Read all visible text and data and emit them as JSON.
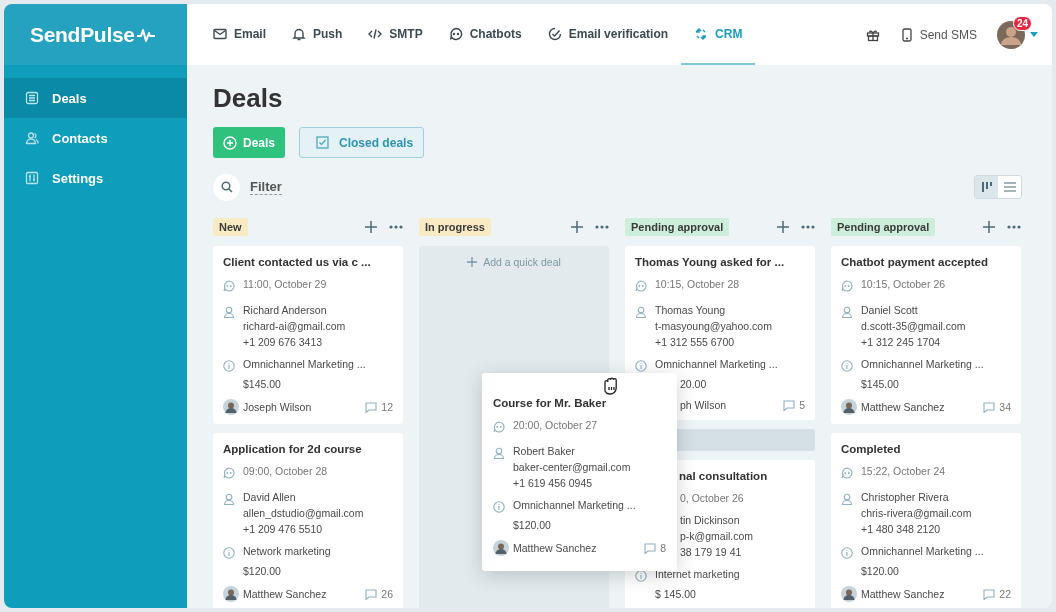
{
  "logo": "SendPulse",
  "nav": [
    {
      "label": "Email",
      "selected": false
    },
    {
      "label": "Push",
      "selected": false
    },
    {
      "label": "SMTP",
      "selected": false
    },
    {
      "label": "Chatbots",
      "selected": false
    },
    {
      "label": "Email verification",
      "selected": false
    },
    {
      "label": "CRM",
      "selected": true
    }
  ],
  "header_right": {
    "sms": "Send SMS",
    "badge": "24"
  },
  "sidebar": [
    {
      "label": "Deals",
      "selected": true
    },
    {
      "label": "Contacts",
      "selected": false
    },
    {
      "label": "Settings",
      "selected": false
    }
  ],
  "title": "Deals",
  "actions": {
    "add": "Deals",
    "closed": "Closed deals"
  },
  "filter": "Filter",
  "view": [
    {
      "selected": true
    },
    {
      "selected": false
    }
  ],
  "columns": [
    {
      "label": "New",
      "color": "#f8ebc4",
      "cards": [
        {
          "kind": "deal",
          "title": {
            "text": "Client contacted us via c ...",
            "cut": false
          },
          "rows": [
            {
              "kind": "time",
              "lines": [
                "11:00, October 29"
              ],
              "cut": false
            },
            {
              "kind": "contact",
              "lines": [
                "Richard Anderson",
                "richard-ai@gmail.com",
                "+1 209 676 3413"
              ],
              "cut": false
            },
            {
              "kind": "deal",
              "lines": [
                "Omnichannel Marketing ..."
              ],
              "cut": false
            },
            {
              "kind": "price",
              "lines": [
                "$145.00"
              ],
              "cut": false
            }
          ],
          "footer": {
            "owner": "Joseph Wilson",
            "comments": "12",
            "cut": false
          }
        },
        {
          "kind": "deal",
          "title": {
            "text": "Application for 2d course",
            "cut": false
          },
          "rows": [
            {
              "kind": "time",
              "lines": [
                "09:00, October 28"
              ],
              "cut": false
            },
            {
              "kind": "contact",
              "lines": [
                "David Allen",
                "allen_dstudio@gmail.com",
                "+1 209 476 5510"
              ],
              "cut": false
            },
            {
              "kind": "deal",
              "lines": [
                "Network marketing"
              ],
              "cut": false
            },
            {
              "kind": "price",
              "lines": [
                "$120.00"
              ],
              "cut": false
            }
          ],
          "footer": {
            "owner": "Matthew Sanchez",
            "comments": "26",
            "cut": false
          }
        }
      ]
    },
    {
      "label": "In progress",
      "color": "#f8ebc4",
      "quick_add": "Add a quick deal"
    },
    {
      "label": "Pending approval",
      "color": "#cdeedb",
      "cards": [
        {
          "kind": "deal",
          "title": {
            "text": "Thomas Young  asked for ...",
            "cut": false
          },
          "rows": [
            {
              "kind": "time",
              "lines": [
                "10:15, October 28"
              ],
              "cut": false
            },
            {
              "kind": "contact",
              "lines": [
                "Thomas Young",
                "t-masyoung@yahoo.com",
                "+1 312 555 6700"
              ],
              "cut": false
            },
            {
              "kind": "deal",
              "lines": [
                "Omnichannel Marketing    ..."
              ],
              "cut": false
            },
            {
              "kind": "price",
              "lines": [
                "20.00"
              ],
              "cut": true
            }
          ],
          "footer": {
            "owner": "ph Wilson",
            "comments": "5",
            "cut": true
          }
        },
        {
          "kind": "drop_slot"
        },
        {
          "kind": "deal",
          "title": {
            "text": "nal consultation",
            "cut": true
          },
          "rows": [
            {
              "kind": "time",
              "lines": [
                "0, October 26"
              ],
              "cut": true
            },
            {
              "kind": "contact",
              "lines": [
                "tin Dickinson",
                "p-k@gmail.com",
                "38 179 19 41"
              ],
              "cut": true
            },
            {
              "kind": "deal",
              "lines": [
                "Internet marketing"
              ],
              "cut": false
            },
            {
              "kind": "price",
              "lines": [
                "$ 145.00"
              ],
              "cut": false
            }
          ]
        }
      ]
    },
    {
      "label": "Pending approval",
      "color": "#cdeedb",
      "cards": [
        {
          "kind": "deal",
          "title": {
            "text": "Chatbot payment accepted",
            "cut": false
          },
          "rows": [
            {
              "kind": "time",
              "lines": [
                "10:15, October 26"
              ],
              "cut": false
            },
            {
              "kind": "contact",
              "lines": [
                "Daniel Scott",
                "d.scott-35@gmail.com",
                "+1 312 245 1704"
              ],
              "cut": false
            },
            {
              "kind": "deal",
              "lines": [
                "Omnichannel Marketing ..."
              ],
              "cut": false
            },
            {
              "kind": "price",
              "lines": [
                "$145.00"
              ],
              "cut": false
            }
          ],
          "footer": {
            "owner": "Matthew Sanchez",
            "comments": "34",
            "cut": false
          }
        },
        {
          "kind": "deal",
          "title": {
            "text": "Completed",
            "cut": false
          },
          "rows": [
            {
              "kind": "time",
              "lines": [
                "15:22, October 24"
              ],
              "cut": false
            },
            {
              "kind": "contact",
              "lines": [
                "Christopher Rivera",
                "chris-rivera@gmail.com",
                "+1 480 348 2120"
              ],
              "cut": false
            },
            {
              "kind": "deal",
              "lines": [
                "Omnichannel Marketing  ..."
              ],
              "cut": false
            },
            {
              "kind": "price",
              "lines": [
                "$120.00"
              ],
              "cut": false
            }
          ],
          "footer": {
            "owner": "Matthew Sanchez",
            "comments": "22",
            "cut": false
          }
        }
      ]
    }
  ],
  "dragged_card": {
    "title": "Course for Mr. Baker",
    "rows": [
      {
        "kind": "time",
        "lines": [
          "20:00, October 27"
        ]
      },
      {
        "kind": "contact",
        "lines": [
          "Robert Baker",
          "baker-center@gmail.com",
          "+1 619 456 0945"
        ]
      },
      {
        "kind": "deal",
        "lines": [
          "Omnichannel Marketing ..."
        ]
      },
      {
        "kind": "price",
        "lines": [
          "$120.00"
        ]
      }
    ],
    "footer": {
      "owner": "Matthew Sanchez",
      "comments": "8"
    }
  }
}
